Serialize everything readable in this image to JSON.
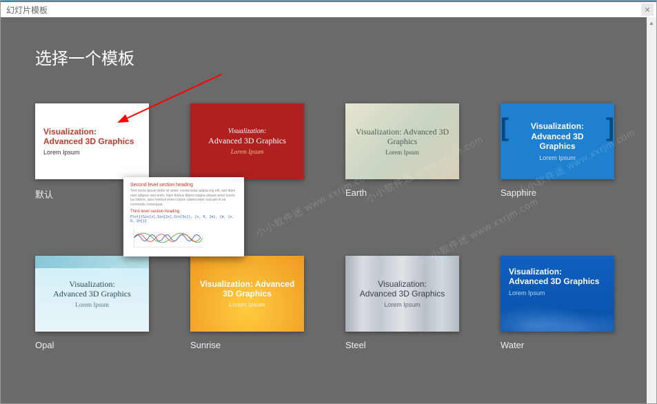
{
  "window": {
    "title": "幻灯片模板"
  },
  "heading": "选择一个模板",
  "sample": {
    "title_line1": "Visualization:",
    "title_line2": "Advanced 3D Graphics",
    "title_combined": "Visualization: Advanced 3D Graphics",
    "subtitle": "Lorem Ipsum"
  },
  "templates": [
    {
      "id": "default",
      "label": "默认"
    },
    {
      "id": "red",
      "label": ""
    },
    {
      "id": "earth",
      "label": "Earth"
    },
    {
      "id": "sapphire",
      "label": "Sapphire"
    },
    {
      "id": "opal",
      "label": "Opal"
    },
    {
      "id": "sunrise",
      "label": "Sunrise"
    },
    {
      "id": "steel",
      "label": "Steel"
    },
    {
      "id": "water",
      "label": "Water"
    }
  ],
  "preview": {
    "section_heading": "Second level section heading",
    "body": "Text lorem ipsum dolor sit amet, consectetur adipiscing elit, sed diam nonl adipisci sed enim. Nam finibus libero magna aliquet amet lorem. Ius bibere, quis nostrud exerci tation ullamcorper suscipit id ea commodo consequat.",
    "sub_heading": "Third level section heading",
    "code": "Plot[{Sin[x],Sin[2x],Sin[3x]}, {x, 0, 2π}, {π, {x, 0, 2π}}]"
  },
  "watermark": "小小软件迷 www.xxrjm.com"
}
